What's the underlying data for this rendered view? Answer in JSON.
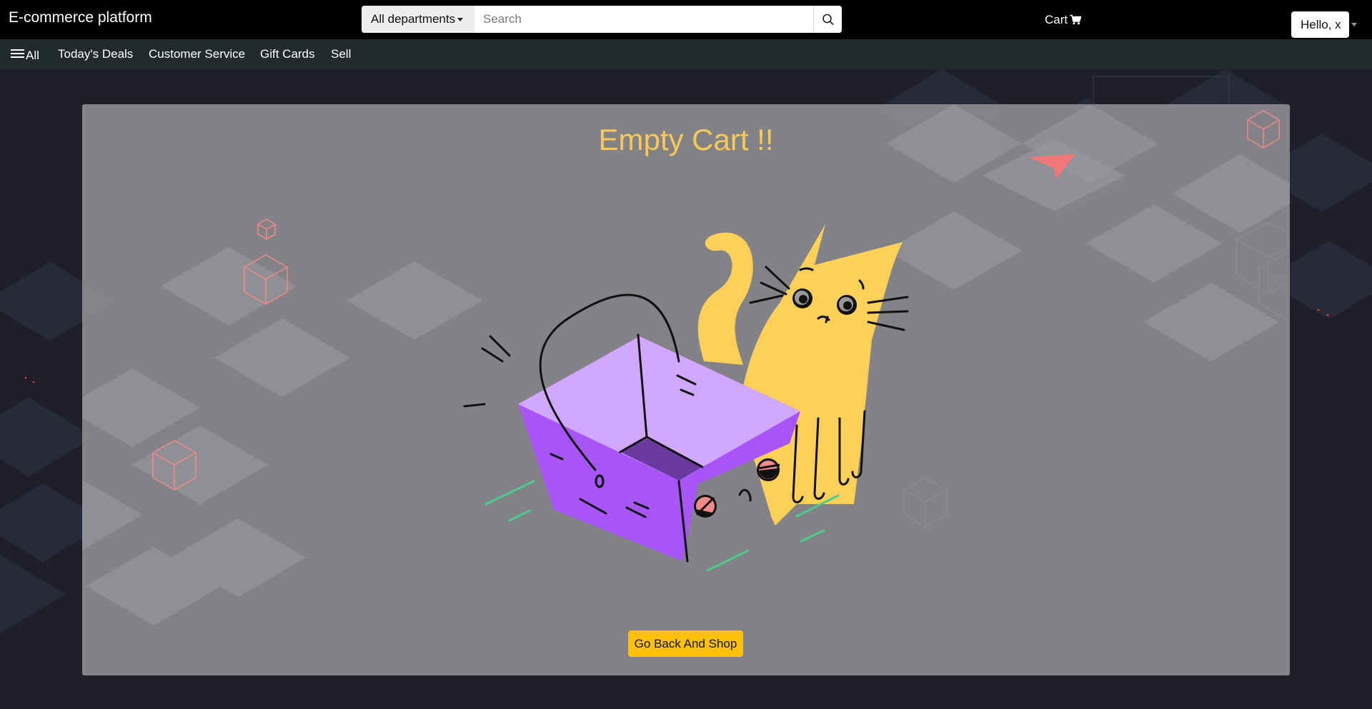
{
  "header": {
    "brand": "E-commerce platform",
    "search": {
      "department_label": "All departments",
      "placeholder": "Search",
      "value": ""
    },
    "cart_label": "Cart",
    "user_label": "Hello, x"
  },
  "nav": {
    "menu_label": "All",
    "items": [
      {
        "label": "Today's Deals"
      },
      {
        "label": "Customer Service"
      },
      {
        "label": "Gift Cards"
      },
      {
        "label": "Sell"
      }
    ]
  },
  "main": {
    "title": "Empty Cart !!",
    "button_label": "Go Back And Shop"
  },
  "icons": {
    "menu": "hamburger-icon",
    "search": "search-icon",
    "cart": "shopping-cart-icon",
    "dropdown": "caret-down-icon"
  },
  "colors": {
    "header_bg": "#000000",
    "nav_bg": "#232a2d",
    "page_bg": "#1f1f2a",
    "panel_bg": "#8a8a8e",
    "title": "#f8c958",
    "button_bg": "#ffc107",
    "basket": "#a855f7",
    "cat": "#fdd05a"
  }
}
